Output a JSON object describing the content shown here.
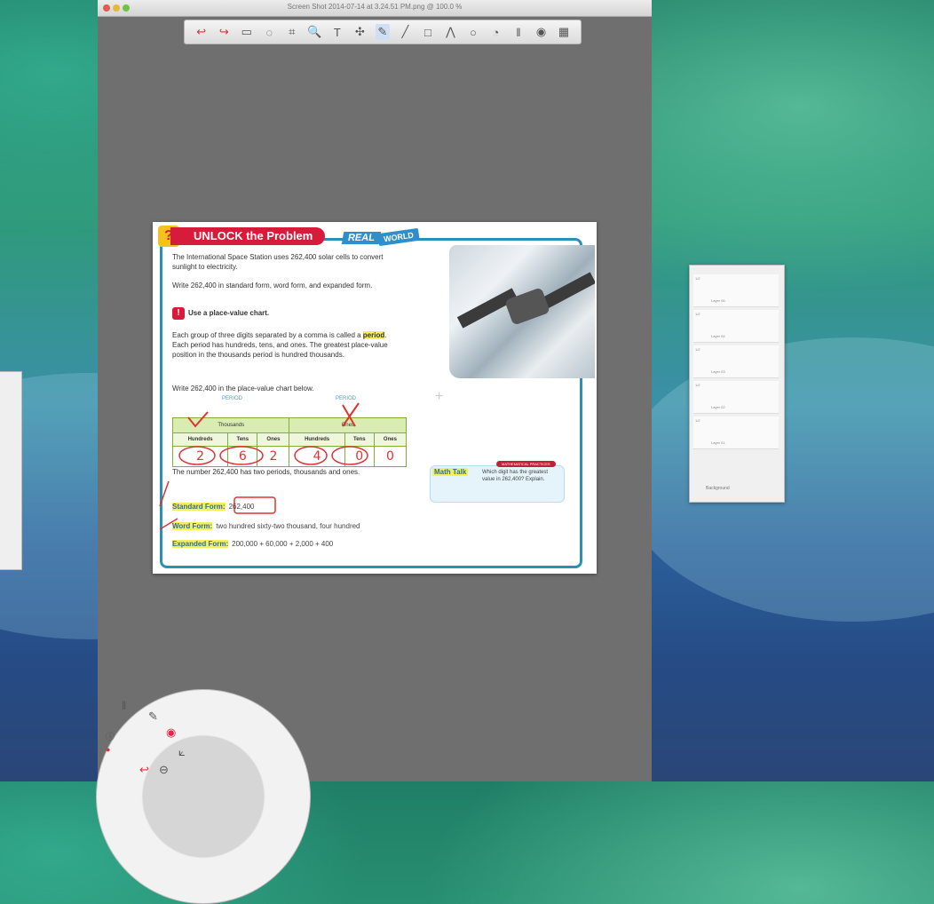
{
  "window": {
    "title": "Screen Shot 2014-07-14 at 3.24.51 PM.png @ 100.0 %"
  },
  "toolbar": {
    "tools": [
      {
        "icon": "undo-arrow-icon",
        "glyph": "↩"
      },
      {
        "icon": "redo-arrow-icon",
        "glyph": "↪"
      },
      {
        "icon": "rectangle-select-icon",
        "glyph": "▭"
      },
      {
        "icon": "lasso-select-icon",
        "glyph": "◌"
      },
      {
        "icon": "crop-icon",
        "glyph": "⌗"
      },
      {
        "icon": "zoom-icon",
        "glyph": "🔍"
      },
      {
        "icon": "text-tool-icon",
        "glyph": "T"
      },
      {
        "icon": "move-icon",
        "glyph": "✣"
      },
      {
        "icon": "pen-icon",
        "glyph": "✎"
      },
      {
        "icon": "line-icon",
        "glyph": "╱"
      },
      {
        "icon": "rectangle-icon",
        "glyph": "□"
      },
      {
        "icon": "polyline-icon",
        "glyph": "⋀"
      },
      {
        "icon": "circle-icon",
        "glyph": "○"
      },
      {
        "icon": "fill-icon",
        "glyph": "◔"
      },
      {
        "icon": "pipette-icon",
        "glyph": "ǁ"
      },
      {
        "icon": "color-wheel-icon",
        "glyph": "◉"
      },
      {
        "icon": "layers-grid-icon",
        "glyph": "▦"
      }
    ]
  },
  "document": {
    "banner": "UNLOCK the Problem",
    "banner_q": "?",
    "real": "REAL",
    "world": "WORLD",
    "intro": "The International Space Station uses 262,400 solar cells to convert sunlight to electricity.",
    "task": "Write 262,400 in standard form, word form, and expanded form.",
    "step_label": "Use a place-value chart.",
    "step_icon": "!",
    "period_text_a": "Each group of three digits separated by a comma is called a ",
    "period_word": "period",
    "period_text_b": ". Each period has hundreds, tens, and ones. The greatest place-value position in the thousands period is hundred thousands.",
    "chart_prompt": "Write 262,400 in the place-value chart below.",
    "period_label_left": "PERIOD",
    "period_label_right": "PERIOD",
    "group_left": "Thousands",
    "group_right": "Ones",
    "headers": [
      "Hundreds",
      "Tens",
      "Ones",
      "Hundreds",
      "Tens",
      "Ones"
    ],
    "digits": [
      "2",
      "6",
      "2",
      "4",
      "0",
      "0"
    ],
    "two_periods": "The number 262,400 has two periods, thousands and ones.",
    "standard_label": "Standard Form:",
    "standard_value": "262,400",
    "word_label": "Word Form:",
    "word_value": "two hundred sixty-two thousand, four hundred",
    "expanded_label": "Expanded Form:",
    "expanded_value": "200,000 + 60,000 + 2,000 + 400",
    "math_talk_label": "Math Talk",
    "math_talk_badge": "MATHEMATICAL PRACTICES",
    "math_talk_text": "Which digit has the greatest value in 262,400? Explain."
  },
  "layers_panel": {
    "layers": [
      {
        "num": "1/2",
        "name": "Layer 06"
      },
      {
        "num": "1/2",
        "name": "Layer 04"
      },
      {
        "num": "1/2",
        "name": "Layer 03"
      },
      {
        "num": "1/2",
        "name": "Layer 02"
      },
      {
        "num": "1/2",
        "name": "Layer 01"
      }
    ],
    "background_label": "Background"
  },
  "colors": {
    "canvas_bg": "#6f6f6f",
    "accent_red": "#d71b3a",
    "accent_blue": "#2d8fb3",
    "highlight": "#f6ef5a",
    "ink_red": "#dd3333"
  }
}
